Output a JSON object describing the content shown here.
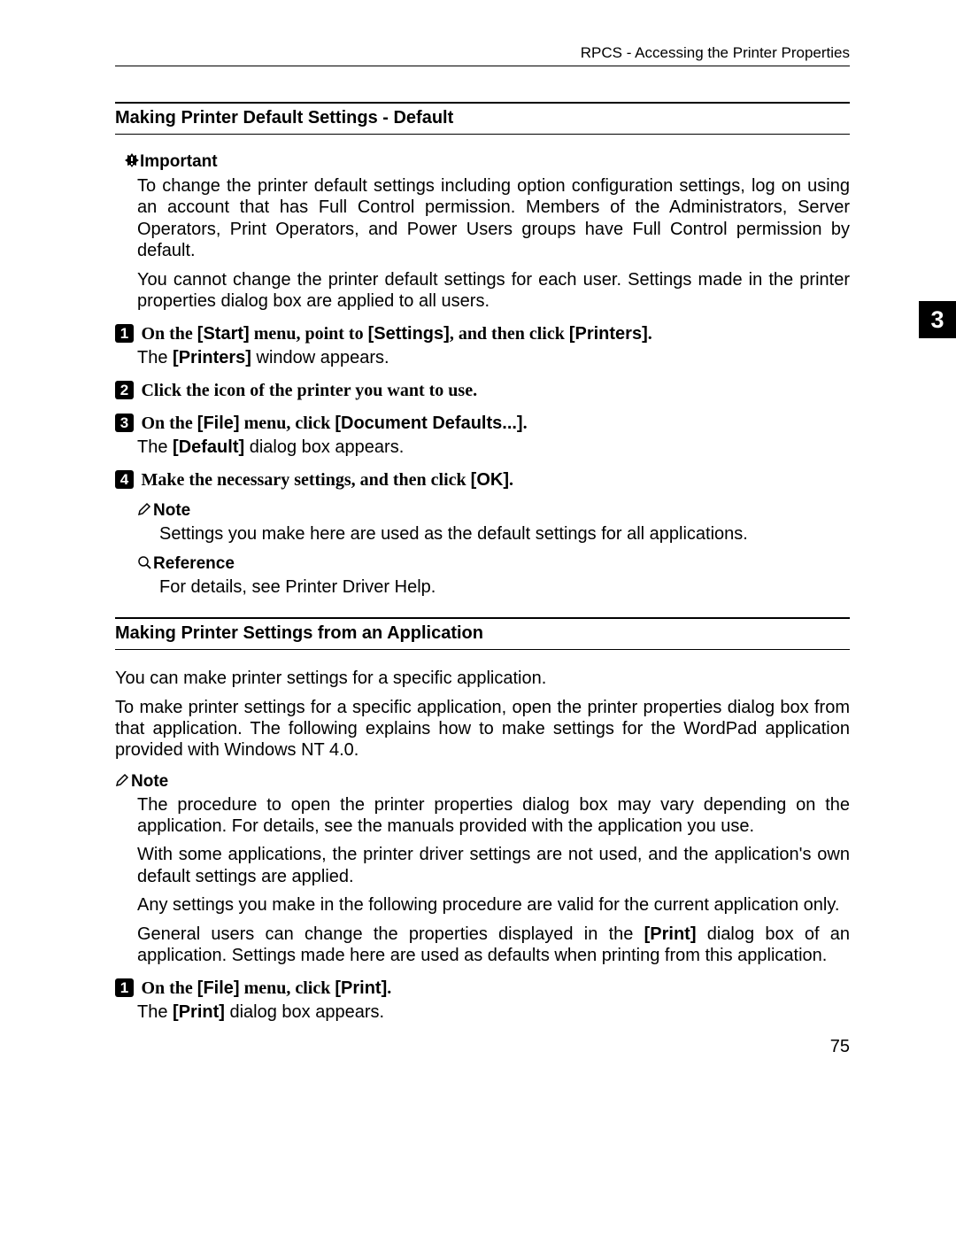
{
  "header": "RPCS - Accessing the Printer Properties",
  "side_tab": "3",
  "page_number": "75",
  "section1": {
    "heading": "Making Printer Default Settings - Default",
    "important_label": "Important",
    "important_p1": "To change the printer default settings including option configuration settings, log on using an account that has Full Control permission. Members of the Administrators, Server Operators, Print Operators, and Power Users groups have Full Control permission by default.",
    "important_p2": "You cannot change the printer default settings for each user. Settings made in the printer properties dialog box are applied to all users.",
    "step1_a": "On the ",
    "step1_b": "[Start]",
    "step1_c": " menu, point to ",
    "step1_d": "[Settings]",
    "step1_e": ", and then click ",
    "step1_f": "[Printers]",
    "step1_g": ".",
    "step1_sub_a": "The ",
    "step1_sub_b": "[Printers]",
    "step1_sub_c": " window appears.",
    "step2": "Click the icon of the printer you want to use.",
    "step3_a": "On the ",
    "step3_b": "[File]",
    "step3_c": " menu, click ",
    "step3_d": "[Document Defaults...]",
    "step3_e": ".",
    "step3_sub_a": "The ",
    "step3_sub_b": "[Default]",
    "step3_sub_c": " dialog box appears.",
    "step4_a": "Make the necessary settings, and then click ",
    "step4_b": "[OK]",
    "step4_c": ".",
    "note_label": "Note",
    "note_text": "Settings you make here are used as the default settings for all applications.",
    "ref_label": "Reference",
    "ref_text": "For details, see Printer Driver Help."
  },
  "section2": {
    "heading": "Making Printer Settings from an Application",
    "intro1": "You can make printer settings for a specific application.",
    "intro2": "To make printer settings for a specific application, open the printer properties dialog box from that application. The following explains how to make settings for the WordPad application provided with Windows NT 4.0.",
    "note_label": "Note",
    "note_p1": "The procedure to open the printer properties dialog box may vary depending on the application. For details, see the manuals provided with the application you use.",
    "note_p2": "With some applications, the printer driver settings are not used, and the application's own default settings are applied.",
    "note_p3": "Any settings you make in the following procedure are valid for the current application only.",
    "note_p4_a": "General users can change the properties displayed in the ",
    "note_p4_b": "[Print]",
    "note_p4_c": " dialog box of an application. Settings made here are used as defaults when printing from this application.",
    "step1_a": "On the ",
    "step1_b": "[File]",
    "step1_c": " menu, click ",
    "step1_d": "[Print]",
    "step1_e": ".",
    "step1_sub_a": "The ",
    "step1_sub_b": "[Print]",
    "step1_sub_c": " dialog box appears."
  }
}
